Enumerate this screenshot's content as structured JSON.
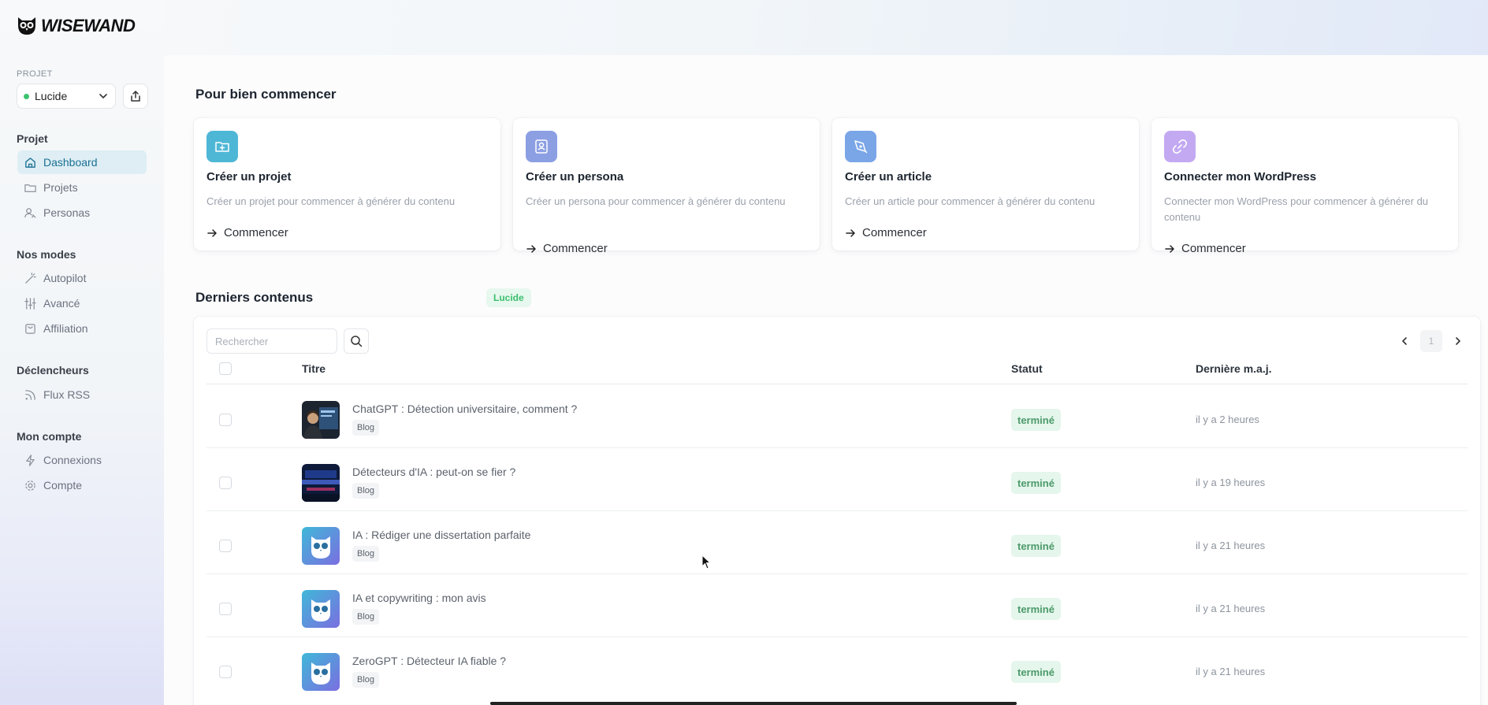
{
  "brand": {
    "name": "WISEWAND"
  },
  "sidebar": {
    "project_label": "PROJET",
    "project_select": "Lucide",
    "sections": [
      {
        "title": "Projet",
        "items": [
          {
            "label": "Dashboard",
            "icon": "home-icon",
            "active": true
          },
          {
            "label": "Projets",
            "icon": "folder-icon"
          },
          {
            "label": "Personas",
            "icon": "users-icon"
          }
        ]
      },
      {
        "title": "Nos modes",
        "items": [
          {
            "label": "Autopilot",
            "icon": "magic-wand-icon"
          },
          {
            "label": "Avancé",
            "icon": "sliders-icon"
          },
          {
            "label": "Affiliation",
            "icon": "shopping-bag-icon"
          }
        ]
      },
      {
        "title": "Déclencheurs",
        "items": [
          {
            "label": "Flux RSS",
            "icon": "rss-icon"
          }
        ]
      },
      {
        "title": "Mon compte",
        "items": [
          {
            "label": "Connexions",
            "icon": "lightning-icon"
          },
          {
            "label": "Compte",
            "icon": "gear-icon"
          }
        ]
      }
    ]
  },
  "getting_started": {
    "title": "Pour bien commencer",
    "cards": [
      {
        "title": "Créer un projet",
        "desc": "Créer un projet pour commencer à générer du contenu",
        "link": "Commencer",
        "icon": "folder-plus-icon",
        "color": "#4fb7d6"
      },
      {
        "title": "Créer un persona",
        "desc": "Créer un persona pour commencer à générer du contenu",
        "link": "Commencer",
        "icon": "user-card-icon",
        "color": "#8c9fe3"
      },
      {
        "title": "Créer un article",
        "desc": "Créer un article pour commencer à générer du contenu",
        "link": "Commencer",
        "icon": "pen-nib-icon",
        "color": "#7aa6e8"
      },
      {
        "title": "Connecter mon WordPress",
        "desc": "Connecter mon WordPress pour commencer à générer du contenu",
        "link": "Commencer",
        "icon": "link-icon",
        "color": "#c3a9f2"
      }
    ]
  },
  "latest": {
    "title": "Derniers contenus",
    "badge": "Lucide",
    "search_placeholder": "Rechercher",
    "page": "1",
    "columns": {
      "title": "Titre",
      "status": "Statut",
      "updated": "Dernière m.a.j."
    },
    "rows": [
      {
        "title": "ChatGPT : Détection universitaire, comment ?",
        "tag": "Blog",
        "status": "terminé",
        "updated": "il y a 2 heures",
        "thumb": "photo"
      },
      {
        "title": "Détecteurs d'IA : peut-on se fier ?",
        "tag": "Blog",
        "status": "terminé",
        "updated": "il y a 19 heures",
        "thumb": "photo-blue"
      },
      {
        "title": "IA : Rédiger une dissertation parfaite",
        "tag": "Blog",
        "status": "terminé",
        "updated": "il y a 21 heures",
        "thumb": "owl"
      },
      {
        "title": "IA et copywriting : mon avis",
        "tag": "Blog",
        "status": "terminé",
        "updated": "il y a 21 heures",
        "thumb": "owl"
      },
      {
        "title": "ZeroGPT : Détecteur IA fiable ?",
        "tag": "Blog",
        "status": "terminé",
        "updated": "il y a 21 heures",
        "thumb": "owl"
      }
    ]
  },
  "colors": {
    "accent": "#1b6f94",
    "active_bg": "#deeef4",
    "success": "#3bbf6e"
  }
}
